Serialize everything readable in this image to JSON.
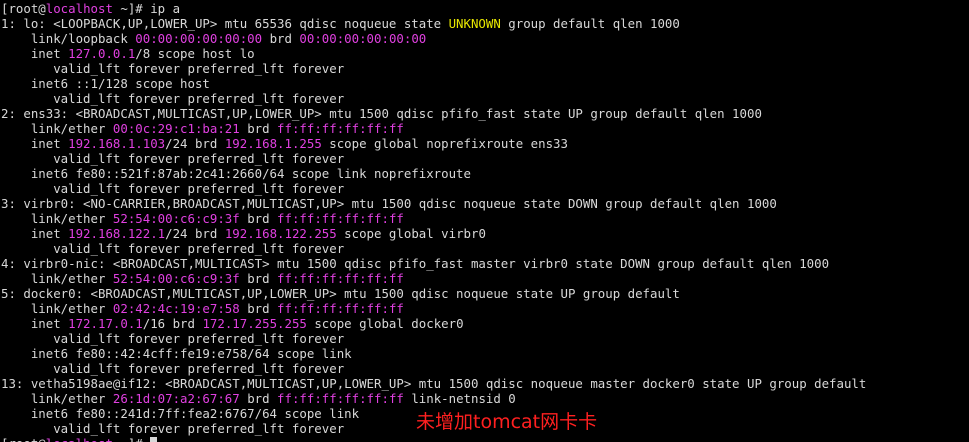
{
  "colors": {
    "background": "#000000",
    "text": "#d8d8d8",
    "highlight_magenta": "#e040e0",
    "highlight_yellow": "#e8e800",
    "annotation": "#ff2020"
  },
  "lines": [
    [
      {
        "t": "[root@"
      },
      {
        "t": "localhost",
        "c": "magenta"
      },
      {
        "t": " ~]# ip a"
      }
    ],
    [
      {
        "t": "1: lo: <LOOPBACK,UP,LOWER_UP> mtu 65536 qdisc noqueue state "
      },
      {
        "t": "UNKNOWN",
        "c": "yellow"
      },
      {
        "t": " group default qlen 1000"
      }
    ],
    [
      {
        "t": "    link/loopback "
      },
      {
        "t": "00:00:00:00:00:00",
        "c": "magenta"
      },
      {
        "t": " brd "
      },
      {
        "t": "00:00:00:00:00:00",
        "c": "magenta"
      }
    ],
    [
      {
        "t": "    inet "
      },
      {
        "t": "127.0.0.1",
        "c": "magenta"
      },
      {
        "t": "/8 scope host lo"
      }
    ],
    [
      {
        "t": "       valid_lft forever preferred_lft forever"
      }
    ],
    [
      {
        "t": "    inet6 ::1/128 scope host"
      }
    ],
    [
      {
        "t": "       valid_lft forever preferred_lft forever"
      }
    ],
    [
      {
        "t": "2: ens33: <BROADCAST,MULTICAST,UP,LOWER_UP> mtu 1500 qdisc pfifo_fast state UP group default qlen 1000"
      }
    ],
    [
      {
        "t": "    link/ether "
      },
      {
        "t": "00:0c:29:c1:ba:21",
        "c": "magenta"
      },
      {
        "t": " brd "
      },
      {
        "t": "ff:ff:ff:ff:ff:ff",
        "c": "magenta"
      }
    ],
    [
      {
        "t": "    inet "
      },
      {
        "t": "192.168.1.103",
        "c": "magenta"
      },
      {
        "t": "/24 brd "
      },
      {
        "t": "192.168.1.255",
        "c": "magenta"
      },
      {
        "t": " scope global noprefixroute ens33"
      }
    ],
    [
      {
        "t": "       valid_lft forever preferred_lft forever"
      }
    ],
    [
      {
        "t": "    inet6 fe80::521f:87ab:2c41:2660/64 scope link noprefixroute"
      }
    ],
    [
      {
        "t": "       valid_lft forever preferred_lft forever"
      }
    ],
    [
      {
        "t": "3: virbr0: <NO-CARRIER,BROADCAST,MULTICAST,UP> mtu 1500 qdisc noqueue state DOWN group default qlen 1000"
      }
    ],
    [
      {
        "t": "    link/ether "
      },
      {
        "t": "52:54:00:c6:c9:3f",
        "c": "magenta"
      },
      {
        "t": " brd "
      },
      {
        "t": "ff:ff:ff:ff:ff:ff",
        "c": "magenta"
      }
    ],
    [
      {
        "t": "    inet "
      },
      {
        "t": "192.168.122.1",
        "c": "magenta"
      },
      {
        "t": "/24 brd "
      },
      {
        "t": "192.168.122.255",
        "c": "magenta"
      },
      {
        "t": " scope global virbr0"
      }
    ],
    [
      {
        "t": "       valid_lft forever preferred_lft forever"
      }
    ],
    [
      {
        "t": "4: virbr0-nic: <BROADCAST,MULTICAST> mtu 1500 qdisc pfifo_fast master virbr0 state DOWN group default qlen 1000"
      }
    ],
    [
      {
        "t": "    link/ether "
      },
      {
        "t": "52:54:00:c6:c9:3f",
        "c": "magenta"
      },
      {
        "t": " brd "
      },
      {
        "t": "ff:ff:ff:ff:ff:ff",
        "c": "magenta"
      }
    ],
    [
      {
        "t": "5: docker0: <BROADCAST,MULTICAST,UP,LOWER_UP> mtu 1500 qdisc noqueue state UP group default"
      }
    ],
    [
      {
        "t": "    link/ether "
      },
      {
        "t": "02:42:4c:19:e7:58",
        "c": "magenta"
      },
      {
        "t": " brd "
      },
      {
        "t": "ff:ff:ff:ff:ff:ff",
        "c": "magenta"
      }
    ],
    [
      {
        "t": "    inet "
      },
      {
        "t": "172.17.0.1",
        "c": "magenta"
      },
      {
        "t": "/16 brd "
      },
      {
        "t": "172.17.255.255",
        "c": "magenta"
      },
      {
        "t": " scope global docker0"
      }
    ],
    [
      {
        "t": "       valid_lft forever preferred_lft forever"
      }
    ],
    [
      {
        "t": "    inet6 fe80::42:4cff:fe19:e758/64 scope link"
      }
    ],
    [
      {
        "t": "       valid_lft forever preferred_lft forever"
      }
    ],
    [
      {
        "t": "13: vetha5198ae@if12: <BROADCAST,MULTICAST,UP,LOWER_UP> mtu 1500 qdisc noqueue master docker0 state UP group default"
      }
    ],
    [
      {
        "t": "    link/ether "
      },
      {
        "t": "26:1d:07:a2:67:67",
        "c": "magenta"
      },
      {
        "t": " brd "
      },
      {
        "t": "ff:ff:ff:ff:ff:ff",
        "c": "magenta"
      },
      {
        "t": " link-netnsid 0"
      }
    ],
    [
      {
        "t": "    inet6 fe80::241d:7ff:fea2:6767/64 scope link"
      }
    ],
    [
      {
        "t": "       valid_lft forever preferred_lft forever"
      }
    ],
    [
      {
        "t": "[root@"
      },
      {
        "t": "localhost",
        "c": "magenta"
      },
      {
        "t": " ~]# "
      }
    ]
  ],
  "annotation": "未增加tomcat网卡卡"
}
